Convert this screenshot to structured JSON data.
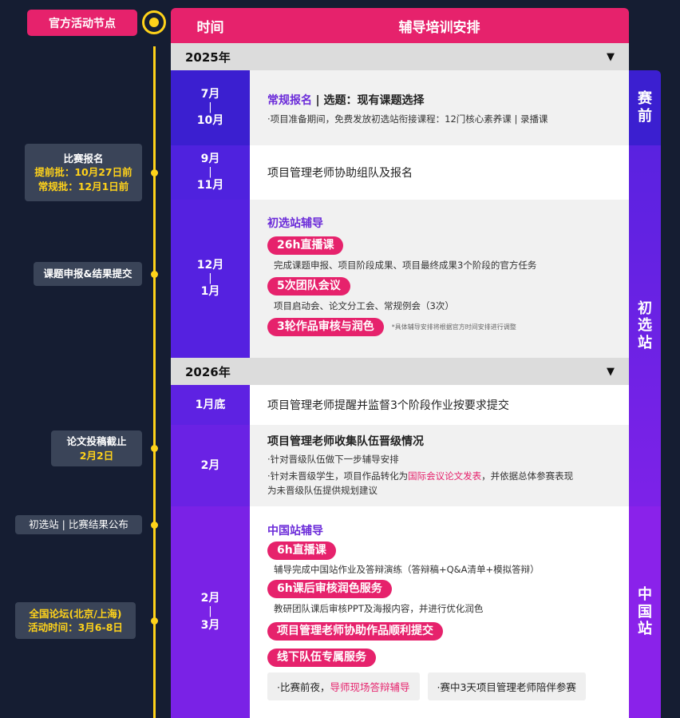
{
  "header": {
    "node_tag": "官方活动节点",
    "time_label": "时间",
    "plan_label": "辅导培训安排"
  },
  "years": [
    "2025年",
    "2026年"
  ],
  "rows": {
    "r1": {
      "time": [
        "7月",
        "|",
        "10月"
      ],
      "title_bold": "常规报名",
      "title_rest": "| 选题：现有课题选择",
      "note": "·项目准备期间，免费发放初选站衔接课程：12门核心素养课 | 录播课"
    },
    "r2": {
      "time": [
        "9月",
        "|",
        "11月"
      ],
      "text": "项目管理老师协助组队及报名"
    },
    "r3": {
      "time": [
        "12月",
        "|",
        "1月"
      ],
      "heading": "初选站辅导",
      "pill1": "26h直播课",
      "desc1": "完成课题申报、项目阶段成果、项目最终成果3个阶段的官方任务",
      "pill2": "5次团队会议",
      "desc2": "项目启动会、论文分工会、常规例会（3次）",
      "pill3": "3轮作品审核与润色",
      "pill3_note": "*具体辅导安排将根据官方时间安排进行调整"
    },
    "r4": {
      "time": "1月底",
      "text": "项目管理老师提醒并监督3个阶段作业按要求提交"
    },
    "r5": {
      "time": "2月",
      "heading": "项目管理老师收集队伍晋级情况",
      "b1": "·针对晋级队伍做下一步辅导安排",
      "b2_pre": "·针对未晋级学生，项目作品转化为",
      "b2_highlight": "国际会议论文发表",
      "b2_post": "，并依据总体参赛表现",
      "b2_line2": "为未晋级队伍提供规划建议"
    },
    "r6": {
      "time": [
        "2月",
        "|",
        "3月"
      ],
      "heading": "中国站辅导",
      "pill1": "6h直播课",
      "desc1": "辅导完成中国站作业及答辩演练（答辩稿+Q&A清单+模拟答辩）",
      "pill2": "6h课后审核润色服务",
      "desc2": "教研团队课后审核PPT及海报内容，并进行优化润色",
      "pill3": "项目管理老师协助作品顺利提交",
      "pill4": "线下队伍专属服务",
      "box1_pre": "·比赛前夜，",
      "box1_highlight": "导师现场答辩辅导",
      "box2": "·赛中3天项目管理老师陪伴参赛"
    }
  },
  "stages": {
    "s1": "赛前",
    "s2": "初选站",
    "s3": "中国站"
  },
  "left_labels": {
    "l1": {
      "title": "比赛报名",
      "line2": "提前批：10月27日前",
      "line3": "常规批：12月1日前"
    },
    "l2": {
      "title": "课题申报&结果提交"
    },
    "l3": {
      "title": "论文投稿截止",
      "line2": "2月2日"
    },
    "l4": {
      "title": "初选站 | 比赛结果公布"
    },
    "l5": {
      "title": "全国论坛(北京/上海)",
      "line2": "活动时间：3月6-8日"
    }
  },
  "colors": {
    "accent_pink": "#e6226c",
    "timeline_yellow": "#ffd21a",
    "purple_dark": "#3b1fd0",
    "purple_mid": "#5b21e0",
    "purple_bright": "#8a2be2",
    "background": "#151d32"
  }
}
